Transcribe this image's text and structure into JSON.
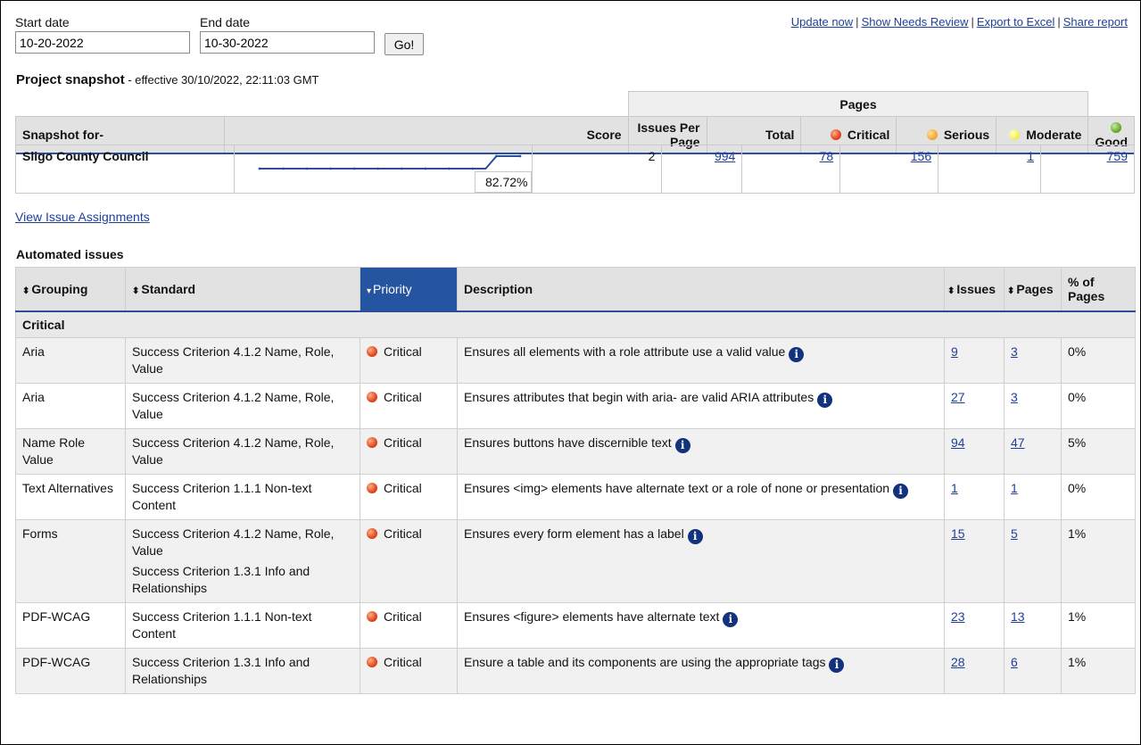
{
  "dates": {
    "start_label": "Start date",
    "start_value": "10-20-2022",
    "end_label": "End date",
    "end_value": "10-30-2022",
    "go_label": "Go!"
  },
  "top_links": [
    "Update now",
    "Show Needs Review",
    "Export to Excel",
    "Share report"
  ],
  "snapshot": {
    "title": "Project snapshot",
    "subtitle": " - effective 30/10/2022, 22:11:03 GMT",
    "pages_header": "Pages",
    "headers": {
      "snapshot_for": "Snapshot for-",
      "score": "Score",
      "issues_per_page": "Issues Per Page",
      "total": "Total",
      "critical": "Critical",
      "serious": "Serious",
      "moderate": "Moderate",
      "good": "Good"
    },
    "row": {
      "name": "Sligo County Council",
      "score": "82.72%",
      "issues_per_page": "2",
      "total": "994",
      "critical": "78",
      "serious": "156",
      "moderate": "1",
      "good": "759"
    },
    "trend": [
      72,
      72,
      72,
      72,
      72,
      72,
      72,
      72,
      72,
      72,
      82.72,
      82.72
    ]
  },
  "view_assignments": "View Issue Assignments",
  "automated": {
    "title": "Automated issues",
    "headers": {
      "grouping": "Grouping",
      "standard": "Standard",
      "priority": "Priority",
      "description": "Description",
      "issues": "Issues",
      "pages": "Pages",
      "pct_pages": "% of Pages"
    },
    "group_label": "Critical",
    "rows": [
      {
        "grouping": "Aria",
        "standards": [
          "Success Criterion 4.1.2 Name, Role, Value"
        ],
        "priority": "Critical",
        "description": "Ensures all elements with a role attribute use a valid value",
        "issues": "9",
        "pages": "3",
        "pct": "0%"
      },
      {
        "grouping": "Aria",
        "standards": [
          "Success Criterion 4.1.2 Name, Role, Value"
        ],
        "priority": "Critical",
        "description": "Ensures attributes that begin with aria- are valid ARIA attributes",
        "issues": "27",
        "pages": "3",
        "pct": "0%"
      },
      {
        "grouping": "Name Role Value",
        "standards": [
          "Success Criterion 4.1.2 Name, Role, Value"
        ],
        "priority": "Critical",
        "description": "Ensures buttons have discernible text",
        "issues": "94",
        "pages": "47",
        "pct": "5%"
      },
      {
        "grouping": "Text Alternatives",
        "standards": [
          "Success Criterion 1.1.1 Non-text Content"
        ],
        "priority": "Critical",
        "description": "Ensures <img> elements have alternate text or a role of none or presentation",
        "issues": "1",
        "pages": "1",
        "pct": "0%"
      },
      {
        "grouping": "Forms",
        "standards": [
          "Success Criterion 4.1.2 Name, Role, Value",
          "Success Criterion 1.3.1 Info and Relationships"
        ],
        "priority": "Critical",
        "description": "Ensures every form element has a label",
        "issues": "15",
        "pages": "5",
        "pct": "1%"
      },
      {
        "grouping": "PDF-WCAG",
        "standards": [
          "Success Criterion 1.1.1 Non-text Content"
        ],
        "priority": "Critical",
        "description": "Ensures <figure> elements have alternate text",
        "issues": "23",
        "pages": "13",
        "pct": "1%"
      },
      {
        "grouping": "PDF-WCAG",
        "standards": [
          "Success Criterion 1.3.1 Info and Relationships"
        ],
        "priority": "Critical",
        "description": "Ensure a table and its components are using the appropriate tags",
        "issues": "28",
        "pages": "6",
        "pct": "1%"
      }
    ]
  },
  "colors": {
    "link": "#1f3f9b",
    "header_accent": "#2554a0",
    "critical": "#e0471b",
    "serious": "#f7a936",
    "moderate": "#f6f05a",
    "good": "#6aaa2e"
  }
}
